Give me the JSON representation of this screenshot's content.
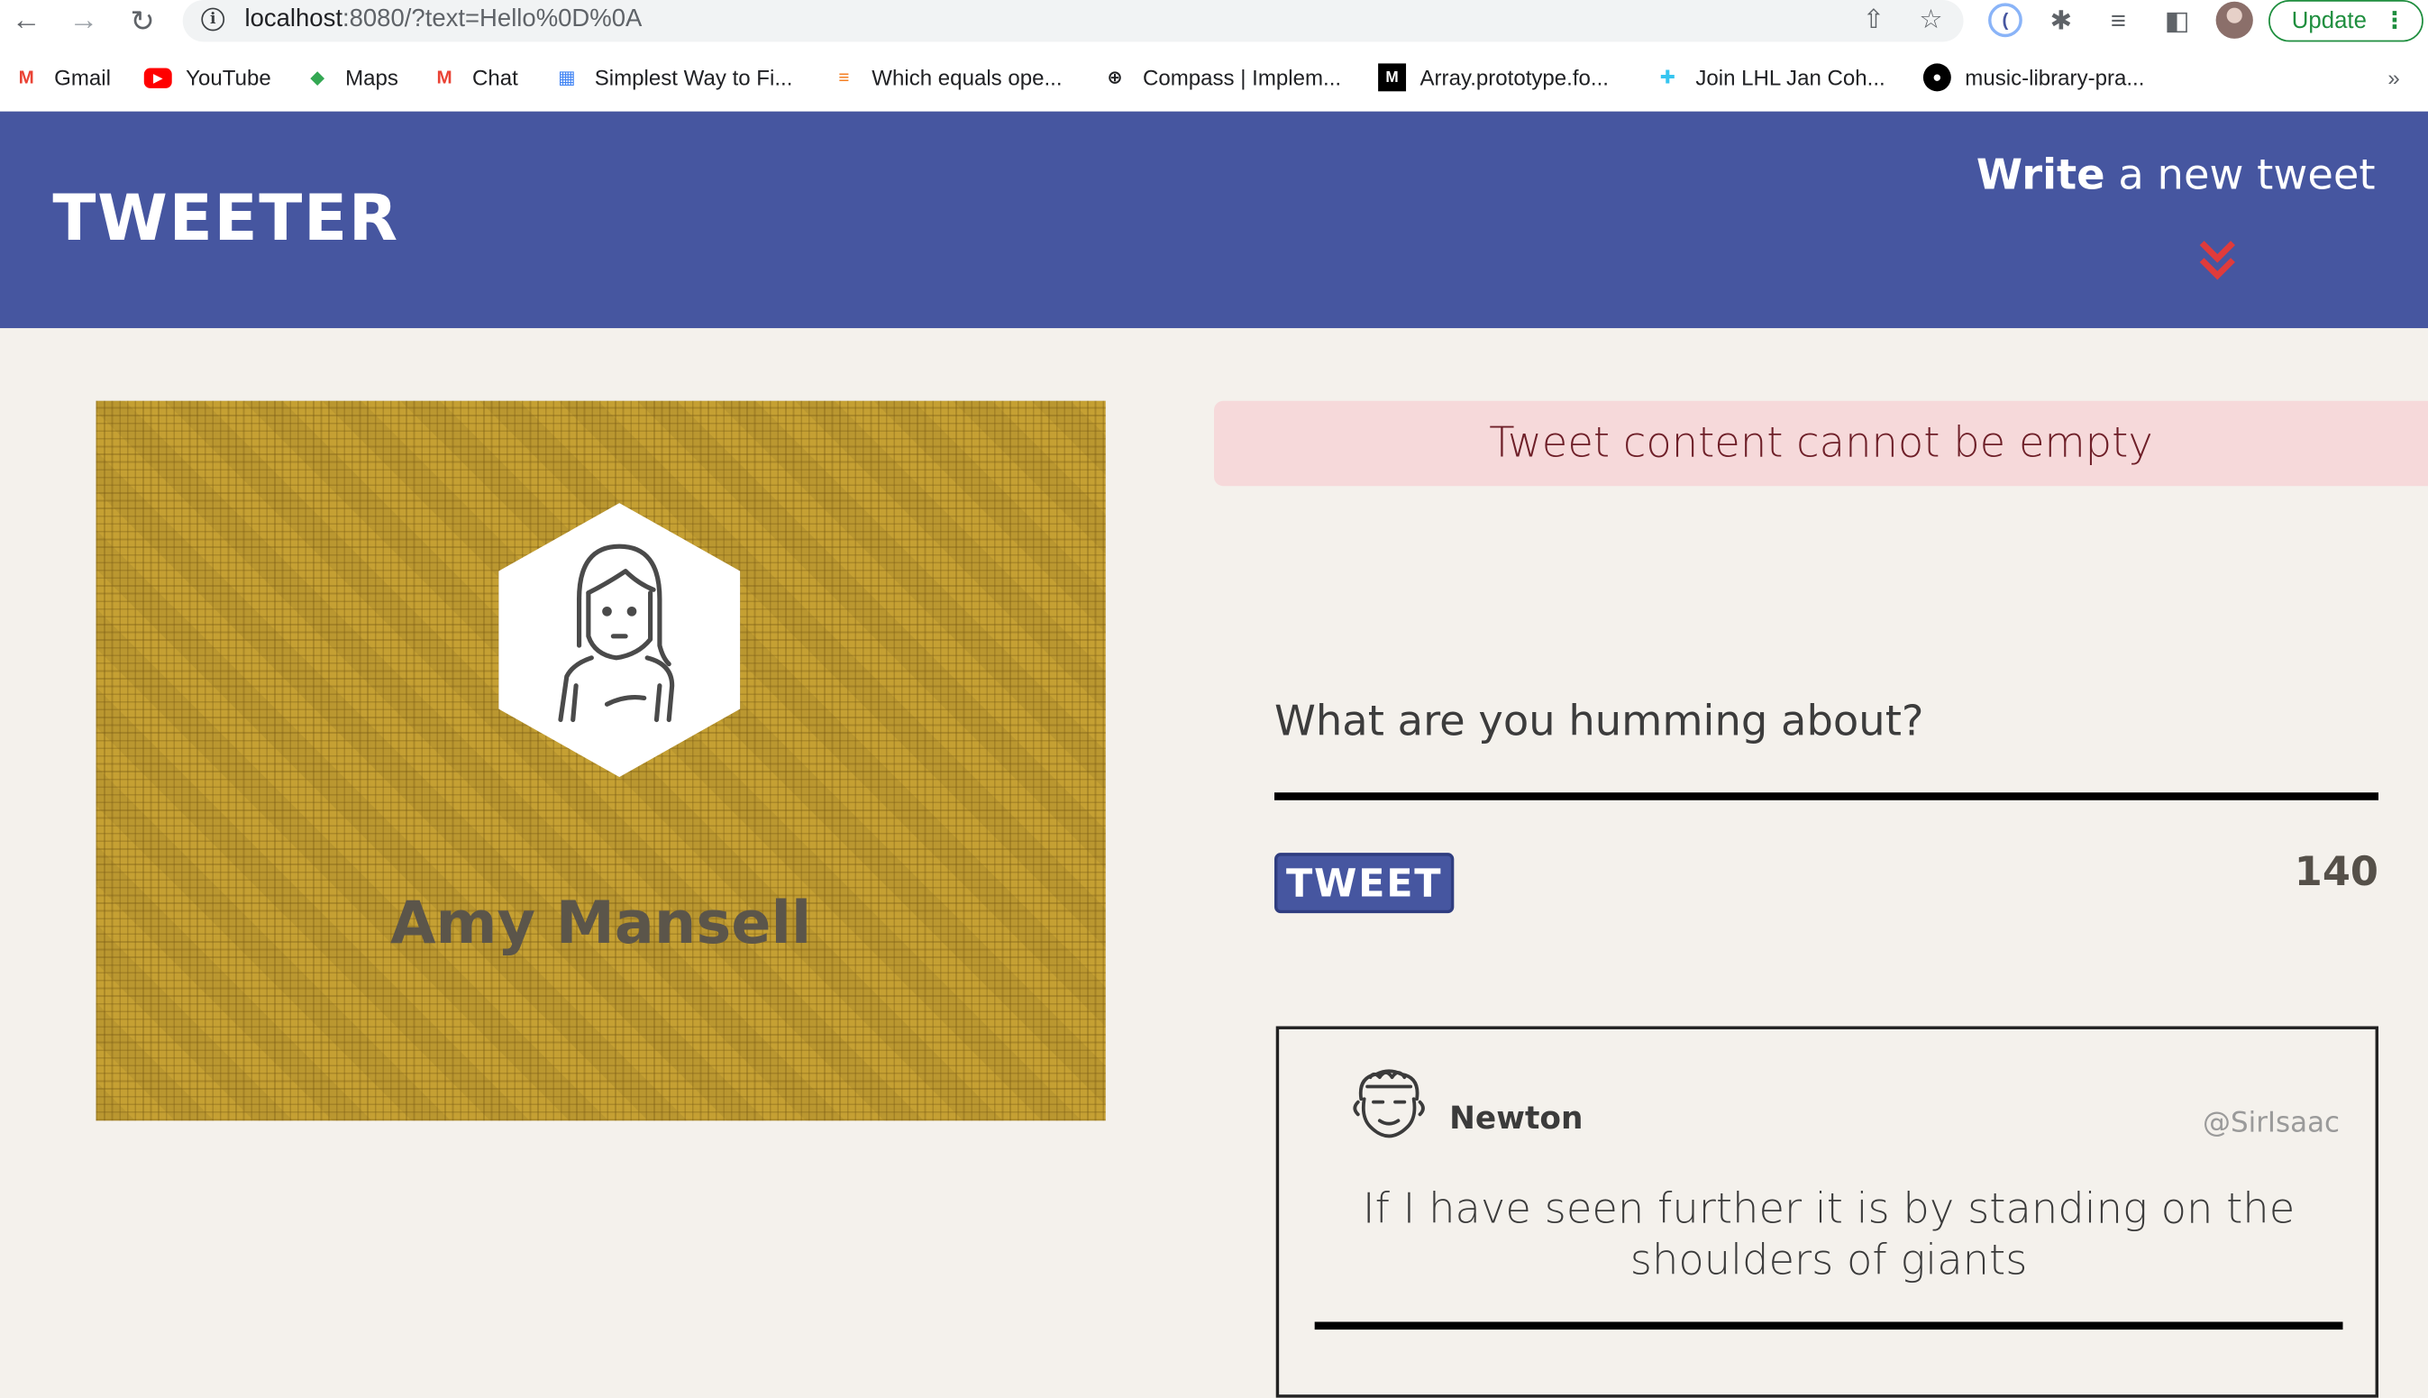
{
  "browser": {
    "url_host": "localhost",
    "url_rest": ":8080/?text=Hello%0D%0A",
    "update_label": "Update",
    "bookmarks": [
      {
        "label": "Gmail",
        "icon": "gmail-icon"
      },
      {
        "label": "YouTube",
        "icon": "youtube-icon"
      },
      {
        "label": "Maps",
        "icon": "maps-icon"
      },
      {
        "label": "Chat",
        "icon": "chat-icon"
      },
      {
        "label": "Simplest Way to Fi...",
        "icon": "page-icon"
      },
      {
        "label": "Which equals ope...",
        "icon": "stackoverflow-icon"
      },
      {
        "label": "Compass | Implem...",
        "icon": "compass-icon"
      },
      {
        "label": "Array.prototype.fo...",
        "icon": "mdn-icon"
      },
      {
        "label": "Join LHL Jan Coh...",
        "icon": "slack-icon"
      },
      {
        "label": "music-library-pra...",
        "icon": "github-icon"
      }
    ]
  },
  "header": {
    "logo": "TWEETER",
    "write_bold": "Write",
    "write_rest": " a new tweet"
  },
  "profile": {
    "name": "Amy Mansell"
  },
  "composer": {
    "error": "Tweet content cannot be empty",
    "placeholder": "What are you humming about?",
    "submit_label": "TWEET",
    "counter": "140"
  },
  "tweet": {
    "author": "Newton",
    "handle": "@SirIsaac",
    "text": "If I have seen further it is by standing on the shoulders of giants"
  },
  "colors": {
    "header_bg": "#4656a0",
    "profile_bg": "#c5a033",
    "error_bg": "#f6d9da",
    "error_text": "#6e1f28",
    "arrow": "#e03b3b"
  }
}
